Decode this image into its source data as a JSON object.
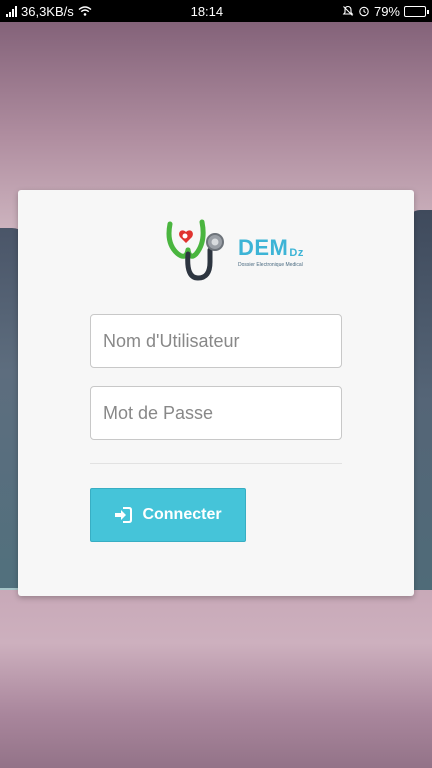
{
  "status_bar": {
    "network_speed": "36,3KB/s",
    "time": "18:14",
    "battery": "79%",
    "battery_level": 0.79,
    "icons": [
      "signal-icon",
      "wifi-icon",
      "mute-icon",
      "alarm-icon",
      "battery-icon"
    ]
  },
  "login": {
    "logo": {
      "brand": "DEM",
      "brand_suffix": "Dz",
      "tagline": "Dossier Electronique Medical"
    },
    "username": {
      "placeholder": "Nom d'Utilisateur",
      "value": ""
    },
    "password": {
      "placeholder": "Mot de Passe",
      "value": ""
    },
    "submit": {
      "label": "Connecter",
      "icon": "sign-in-icon"
    }
  },
  "colors": {
    "accent": "#45c4d9",
    "brand": "#3db4d6",
    "card": "#f7f7f7"
  }
}
